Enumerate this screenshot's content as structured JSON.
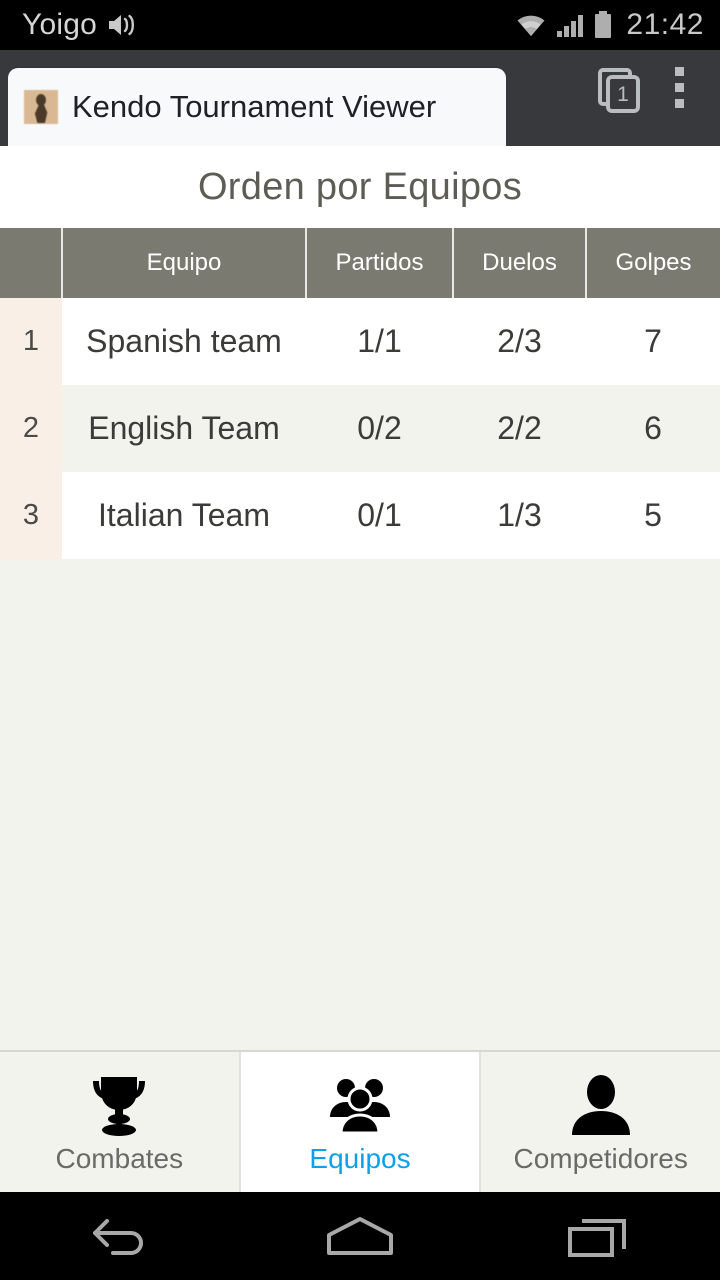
{
  "status_bar": {
    "carrier": "Yoigo",
    "clock": "21:42",
    "icons": [
      "volume-icon",
      "wifi-icon",
      "cellular-signal-icon",
      "battery-icon"
    ]
  },
  "browser": {
    "tab_title": "Kendo Tournament Viewer",
    "favicon": "kendo-fighter-favicon",
    "tab_count": "1",
    "overflow_menu": "more-options-icon"
  },
  "page": {
    "title": "Orden por Equipos"
  },
  "table": {
    "headers": [
      "",
      "Equipo",
      "Partidos",
      "Duelos",
      "Golpes"
    ],
    "rows": [
      {
        "rank": "1",
        "team": "Spanish team",
        "partidos": "1/1",
        "duelos": "2/3",
        "golpes": "7"
      },
      {
        "rank": "2",
        "team": "English Team",
        "partidos": "0/2",
        "duelos": "2/2",
        "golpes": "6"
      },
      {
        "rank": "3",
        "team": "Italian Team",
        "partidos": "0/1",
        "duelos": "1/3",
        "golpes": "5"
      }
    ]
  },
  "bottom_tabs": [
    {
      "label": "Combates",
      "icon": "trophy-icon",
      "active": false
    },
    {
      "label": "Equipos",
      "icon": "group-people-icon",
      "active": true
    },
    {
      "label": "Competidores",
      "icon": "person-icon",
      "active": false
    }
  ],
  "nav_bar": {
    "back": "back-icon",
    "home": "home-icon",
    "recents": "recent-apps-icon"
  },
  "colors": {
    "accent": "#0aa0ea",
    "table_header": "#7a7a70",
    "rank_column": "#faefe6",
    "page_bg": "#f3f3ee",
    "title_text": "#5d5d55"
  }
}
